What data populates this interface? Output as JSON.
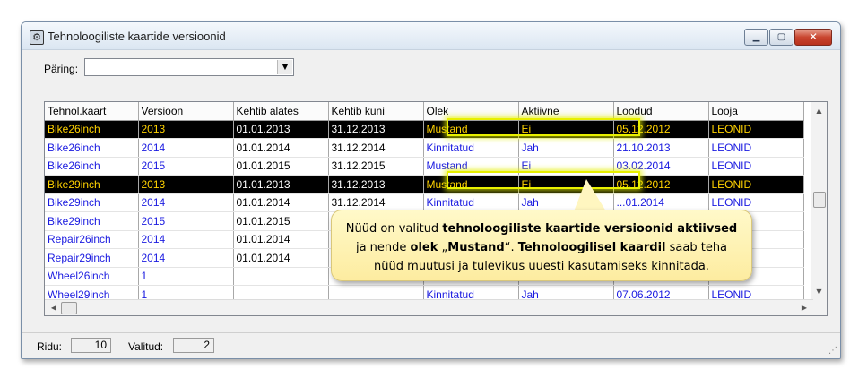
{
  "window": {
    "title": "Tehnoloogiliste kaartide versioonid"
  },
  "query": {
    "label": "Päring:",
    "value": ""
  },
  "table": {
    "columns": [
      "Tehnol.kaart",
      "Versioon",
      "Kehtib alates",
      "Kehtib kuni",
      "Olek",
      "Aktiivne",
      "Loodud",
      "Looja"
    ],
    "rows": [
      {
        "selected": true,
        "cells": [
          "Bike26inch",
          "2013",
          "01.01.2013",
          "31.12.2013",
          "Mustand",
          "Ei",
          "05.12.2012",
          "LEONID"
        ]
      },
      {
        "selected": false,
        "cells": [
          "Bike26inch",
          "2014",
          "01.01.2014",
          "31.12.2014",
          "Kinnitatud",
          "Jah",
          "21.10.2013",
          "LEONID"
        ]
      },
      {
        "selected": false,
        "cells": [
          "Bike26inch",
          "2015",
          "01.01.2015",
          "31.12.2015",
          "Mustand",
          "Ei",
          "03.02.2014",
          "LEONID"
        ]
      },
      {
        "selected": true,
        "cells": [
          "Bike29inch",
          "2013",
          "01.01.2013",
          "31.12.2013",
          "Mustand",
          "Ei",
          "05.12.2012",
          "LEONID"
        ]
      },
      {
        "selected": false,
        "cells": [
          "Bike29inch",
          "2014",
          "01.01.2014",
          "31.12.2014",
          "Kinnitatud",
          "Jah",
          "...01.2014",
          "LEONID"
        ]
      },
      {
        "selected": false,
        "cells": [
          "Bike29inch",
          "2015",
          "01.01.2015",
          "",
          "",
          "",
          "",
          ""
        ]
      },
      {
        "selected": false,
        "cells": [
          "Repair26inch",
          "2014",
          "01.01.2014",
          "",
          "",
          "",
          "",
          ""
        ]
      },
      {
        "selected": false,
        "cells": [
          "Repair29inch",
          "2014",
          "01.01.2014",
          "",
          "",
          "",
          "",
          ""
        ]
      },
      {
        "selected": false,
        "cells": [
          "Wheel26inch",
          "1",
          "",
          "",
          "",
          "",
          "",
          ""
        ]
      },
      {
        "selected": false,
        "cells": [
          "Wheel29inch",
          "1",
          "",
          "",
          "Kinnitatud",
          "Jah",
          "07.06.2012",
          "LEONID"
        ]
      }
    ]
  },
  "status": {
    "rows_label": "Ridu:",
    "rows_value": "10",
    "selected_label": "Valitud:",
    "selected_value": "2"
  },
  "callout": {
    "line1_a": "Nüüd on valitud ",
    "line1_b": "tehnoloogiliste kaartide versioonid aktiivsed",
    "line2_a": "ja nende ",
    "line2_b": "olek",
    "line2_c": " „",
    "line2_d": "Mustand",
    "line2_e": "“. ",
    "line2_f": "Tehnoloogilisel kaardil",
    "line2_g": " saab teha",
    "line3": "nüüd muutusi ja tulevikus uuesti kasutamiseks kinnitada."
  },
  "icons": {
    "app": "app-window-icon",
    "minimize": "minimize-icon",
    "maximize": "maximize-icon",
    "close": "close-icon"
  },
  "colors": {
    "selected_row_bg": "#000000",
    "selected_row_text": "#ffd200",
    "link_text": "#1a1ae0",
    "highlight": "#e8f000",
    "callout_bg": "#fdeca0"
  }
}
